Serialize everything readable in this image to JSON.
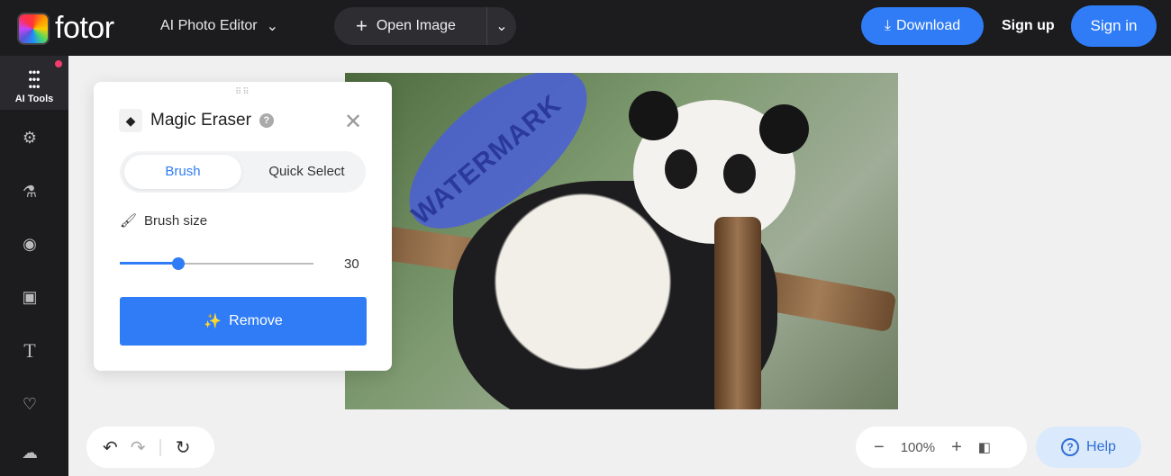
{
  "header": {
    "logo": "fotor",
    "editor_menu": "AI Photo Editor",
    "open_image": "Open Image",
    "download": "Download",
    "sign_up": "Sign up",
    "sign_in": "Sign in"
  },
  "sidebar": {
    "ai_tools": "AI Tools",
    "items": [
      "adjust",
      "beauty",
      "eye",
      "frame",
      "text",
      "elements",
      "upload"
    ]
  },
  "panel": {
    "title": "Magic Eraser",
    "help": "?",
    "tabs": [
      "Brush",
      "Quick Select"
    ],
    "active_tab": "Brush",
    "brush_size_label": "Brush size",
    "brush_size": 30,
    "brush_size_max": 100,
    "remove": "Remove"
  },
  "image": {
    "watermark": "WATERMARK"
  },
  "footer": {
    "zoom": "100%",
    "help": "Help"
  },
  "colors": {
    "accent": "#2f7cf6",
    "topbar": "#1c1c1f"
  }
}
